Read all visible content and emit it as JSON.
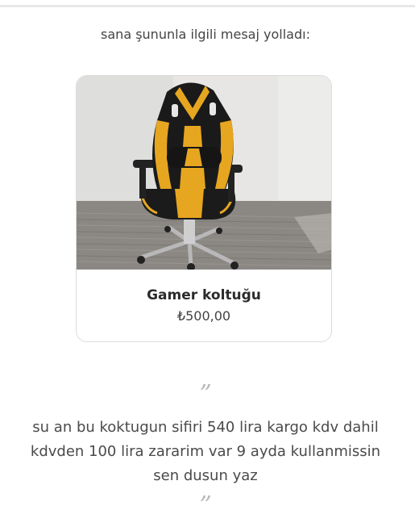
{
  "header": {
    "text": "sana şununla ilgili mesaj yolladı:"
  },
  "product": {
    "title": "Gamer koltuğu",
    "price": "₺500,00",
    "image_icon": "gaming-chair-photo"
  },
  "quote": {
    "open_mark": "”",
    "close_mark": "”",
    "message": "su an bu koktugun sifiri 540 lira kargo kdv dahil kdvden 100 lira zararim var 9 ayda kullanmissin sen dusun yaz"
  },
  "colors": {
    "chair_yellow": "#e8a81f",
    "chair_black": "#1a1a1a",
    "wall": "#e6e6e6",
    "floor": "#8a8680"
  }
}
